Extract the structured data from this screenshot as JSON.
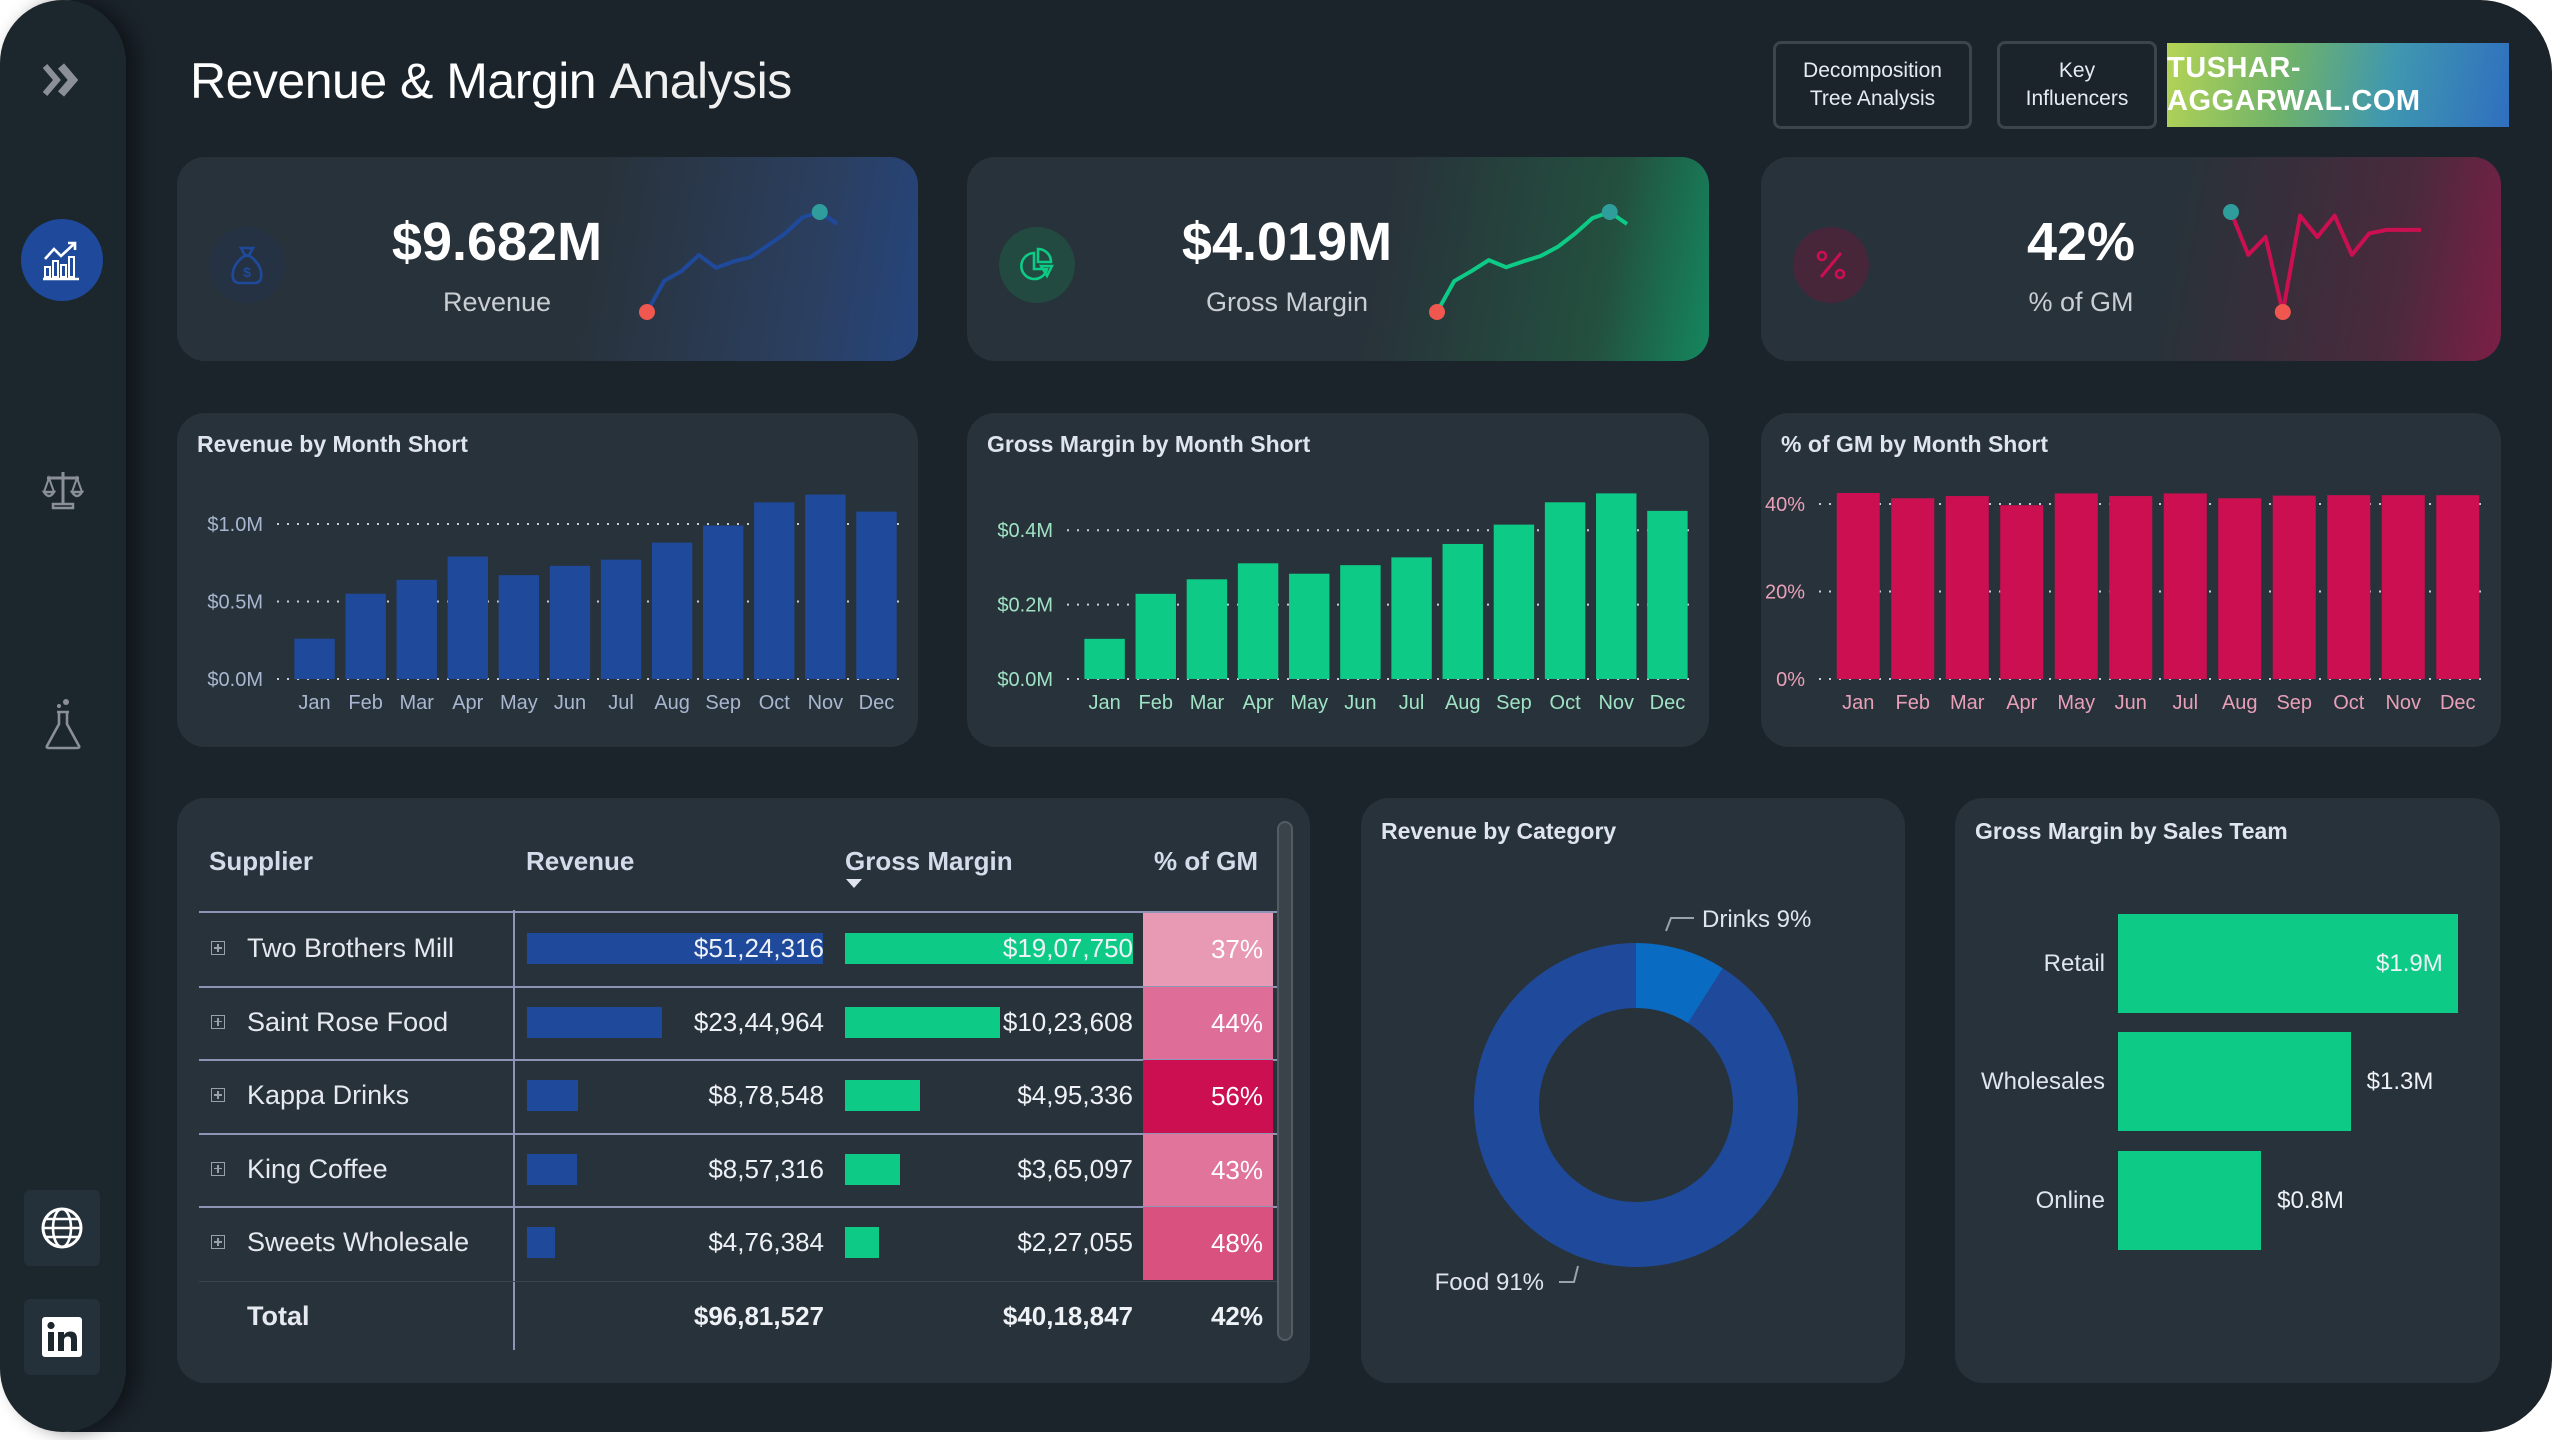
{
  "header": {
    "title_strong": "Revenue & Margin",
    "title_light": "Analysis",
    "buttons": [
      {
        "line1": "Decomposition",
        "line2": "Tree Analysis"
      },
      {
        "line1": "Key",
        "line2": "Influencers"
      }
    ],
    "brand": "TUSHAR-AGGARWAL.COM"
  },
  "sidebar": {
    "items": [
      {
        "icon": "double-chevron-right-icon"
      },
      {
        "icon": "chart-growth-icon",
        "active": true
      },
      {
        "icon": "balance-scale-icon"
      },
      {
        "icon": "flask-icon"
      },
      {
        "icon": "globe-icon"
      },
      {
        "icon": "linkedin-icon"
      }
    ]
  },
  "kpis": [
    {
      "value": "$9.682M",
      "label": "Revenue",
      "icon": "money-bag-icon",
      "color": "#1f4a9c",
      "spark": [
        0.26,
        0.55,
        0.64,
        0.79,
        0.67,
        0.73,
        0.77,
        0.88,
        0.99,
        1.14,
        1.19,
        1.08
      ]
    },
    {
      "value": "$4.019M",
      "label": "Gross Margin",
      "icon": "pie-chart-icon",
      "color": "#0dcb86",
      "spark": [
        0.108,
        0.229,
        0.268,
        0.311,
        0.283,
        0.306,
        0.327,
        0.363,
        0.415,
        0.475,
        0.499,
        0.452
      ]
    },
    {
      "value": "42%",
      "label": "% of GM",
      "icon": "percent-icon",
      "color": "#cc0f50",
      "spark": [
        42.5,
        41.3,
        41.8,
        39.7,
        42.4,
        41.8,
        42.4,
        41.3,
        41.9,
        42.0,
        42.0,
        42.0
      ]
    }
  ],
  "chart_data": [
    {
      "type": "bar",
      "title": "Revenue by Month Short",
      "categories": [
        "Jan",
        "Feb",
        "Mar",
        "Apr",
        "May",
        "Jun",
        "Jul",
        "Aug",
        "Sep",
        "Oct",
        "Nov",
        "Dec"
      ],
      "values": [
        0.26,
        0.55,
        0.64,
        0.79,
        0.67,
        0.73,
        0.77,
        0.88,
        0.99,
        1.14,
        1.19,
        1.08
      ],
      "unit": "$M",
      "yticks": [
        {
          "v": 0,
          "label": "$0.0M"
        },
        {
          "v": 0.5,
          "label": "$0.5M"
        },
        {
          "v": 1.0,
          "label": "$1.0M"
        }
      ],
      "ylim": [
        0,
        1.2
      ],
      "color": "#1f4a9c",
      "tick_color": "#a9b6d0",
      "grid": true
    },
    {
      "type": "bar",
      "title": "Gross Margin by Month Short",
      "categories": [
        "Jan",
        "Feb",
        "Mar",
        "Apr",
        "May",
        "Jun",
        "Jul",
        "Aug",
        "Sep",
        "Oct",
        "Nov",
        "Dec"
      ],
      "values": [
        0.108,
        0.229,
        0.268,
        0.311,
        0.283,
        0.306,
        0.327,
        0.363,
        0.415,
        0.475,
        0.499,
        0.452
      ],
      "unit": "$M",
      "yticks": [
        {
          "v": 0,
          "label": "$0.0M"
        },
        {
          "v": 0.2,
          "label": "$0.2M"
        },
        {
          "v": 0.4,
          "label": "$0.4M"
        }
      ],
      "ylim": [
        0,
        0.5
      ],
      "color": "#0dcb86",
      "tick_color": "#9fe3c4",
      "grid": true
    },
    {
      "type": "bar",
      "title": "% of GM by Month Short",
      "categories": [
        "Jan",
        "Feb",
        "Mar",
        "Apr",
        "May",
        "Jun",
        "Jul",
        "Aug",
        "Sep",
        "Oct",
        "Nov",
        "Dec"
      ],
      "values": [
        42.5,
        41.3,
        41.8,
        39.7,
        42.4,
        41.8,
        42.4,
        41.3,
        41.9,
        42.0,
        42.0,
        42.0
      ],
      "unit": "%",
      "yticks": [
        {
          "v": 0,
          "label": "0%"
        },
        {
          "v": 20,
          "label": "20%"
        },
        {
          "v": 40,
          "label": "40%"
        }
      ],
      "ylim": [
        0,
        42.5
      ],
      "color": "#cc0f50",
      "tick_color": "#e8a0b8",
      "grid": true
    },
    {
      "type": "pie",
      "title": "Revenue by Category",
      "donut": true,
      "slices": [
        {
          "label": "Drinks",
          "pct": 9,
          "display": "Drinks 9%",
          "color": "#0a6bc2"
        },
        {
          "label": "Food",
          "pct": 91,
          "display": "Food 91%",
          "color": "#1f4a9c"
        }
      ]
    },
    {
      "type": "bar",
      "orientation": "horizontal",
      "title": "Gross Margin by Sales Team",
      "categories": [
        "Retail",
        "Wholesales",
        "Online"
      ],
      "values": [
        1.9,
        1.3,
        0.8
      ],
      "labels": [
        "$1.9M",
        "$1.3M",
        "$0.8M"
      ],
      "unit": "$M",
      "color": "#0dcb86"
    }
  ],
  "table": {
    "headers": [
      "Supplier",
      "Revenue",
      "Gross Margin",
      "% of GM"
    ],
    "sorted_column": "Gross Margin",
    "rows": [
      {
        "supplier": "Two Brothers Mill",
        "revenue": "$51,24,316",
        "rev_value": 5124316,
        "gm": "$19,07,750",
        "gm_value": 1907750,
        "pct": "37%",
        "pct_color": "#e89ab4"
      },
      {
        "supplier": "Saint Rose Food",
        "revenue": "$23,44,964",
        "rev_value": 2344964,
        "gm": "$10,23,608",
        "gm_value": 1023608,
        "pct": "44%",
        "pct_color": "#de6e97"
      },
      {
        "supplier": "Kappa Drinks",
        "revenue": "$8,78,548",
        "rev_value": 878548,
        "gm": "$4,95,336",
        "gm_value": 495336,
        "pct": "56%",
        "pct_color": "#cc0f50"
      },
      {
        "supplier": "King Coffee",
        "revenue": "$8,57,316",
        "rev_value": 857316,
        "gm": "$3,65,097",
        "gm_value": 365097,
        "pct": "43%",
        "pct_color": "#e0749b"
      },
      {
        "supplier": "Sweets Wholesale",
        "revenue": "$4,76,384",
        "rev_value": 476384,
        "gm": "$2,27,055",
        "gm_value": 227055,
        "pct": "48%",
        "pct_color": "#d9517f"
      }
    ],
    "total": {
      "label": "Total",
      "revenue": "$96,81,527",
      "gm": "$40,18,847",
      "pct": "42%"
    }
  }
}
